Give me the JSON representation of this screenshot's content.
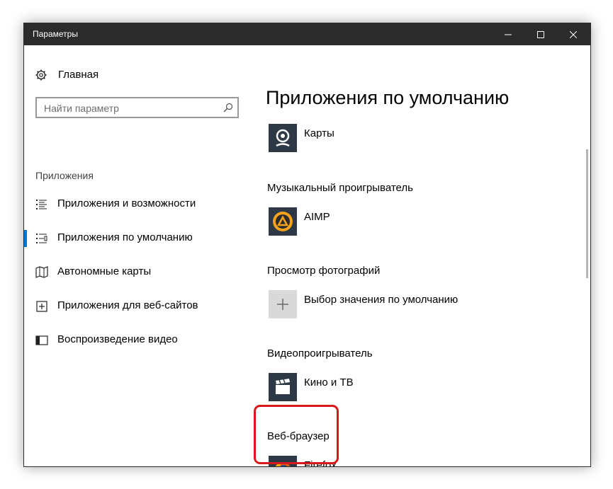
{
  "window": {
    "title": "Параметры"
  },
  "sidebar": {
    "home_label": "Главная",
    "search_placeholder": "Найти параметр",
    "section_title": "Приложения",
    "items": [
      {
        "label": "Приложения и возможности",
        "icon": "list-icon"
      },
      {
        "label": "Приложения по умолчанию",
        "icon": "default-apps-icon",
        "selected": true
      },
      {
        "label": "Автономные карты",
        "icon": "map-icon"
      },
      {
        "label": "Приложения для веб-сайтов",
        "icon": "web-app-icon"
      },
      {
        "label": "Воспроизведение видео",
        "icon": "video-icon"
      }
    ]
  },
  "main": {
    "title": "Приложения по умолчанию",
    "sections": [
      {
        "category": "",
        "app": "Карты",
        "icon": "maps-app-icon"
      },
      {
        "category": "Музыкальный проигрыватель",
        "app": "AIMP",
        "icon": "aimp-icon"
      },
      {
        "category": "Просмотр фотографий",
        "app": "Выбор значения по умолчанию",
        "icon": "plus-icon"
      },
      {
        "category": "Видеопроигрыватель",
        "app": "Кино и ТВ",
        "icon": "movies-tv-icon"
      },
      {
        "category": "Веб-браузер",
        "app": "Firefox",
        "icon": "firefox-icon"
      }
    ]
  },
  "colors": {
    "titlebar": "#2b2b2b",
    "accent": "#0078d7",
    "tile": "#2d3a46",
    "highlight": "#d7191c"
  }
}
